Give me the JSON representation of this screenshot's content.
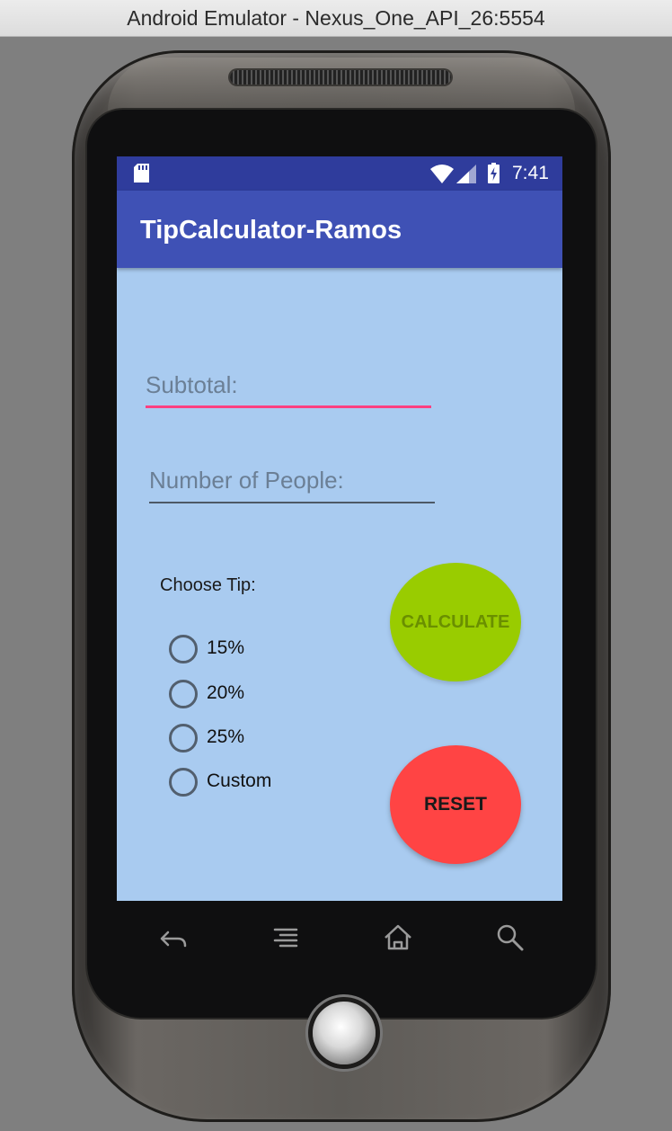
{
  "window": {
    "title": "Android Emulator - Nexus_One_API_26:5554"
  },
  "status_bar": {
    "time": "7:41",
    "icons": [
      "sd-card-icon",
      "wifi-icon",
      "signal-icon",
      "battery-charging-icon"
    ]
  },
  "app_bar": {
    "title": "TipCalculator-Ramos",
    "color": "#3f51b5"
  },
  "form": {
    "subtotal": {
      "value": "",
      "placeholder": "Subtotal:"
    },
    "people": {
      "value": "",
      "placeholder": "Number of People:"
    },
    "tip_label": "Choose Tip:",
    "tip_options": [
      "15%",
      "20%",
      "25%",
      "Custom"
    ]
  },
  "buttons": {
    "calculate": {
      "label": "CALCULATE",
      "color": "#99cc00"
    },
    "reset": {
      "label": "RESET",
      "color": "#ff4444"
    }
  },
  "nav_keys": [
    "back-icon",
    "menu-icon",
    "home-icon",
    "search-icon"
  ],
  "colors": {
    "background": "#a9cbf0",
    "accent": "#ff4081",
    "status_bar": "#2f3c9c"
  }
}
